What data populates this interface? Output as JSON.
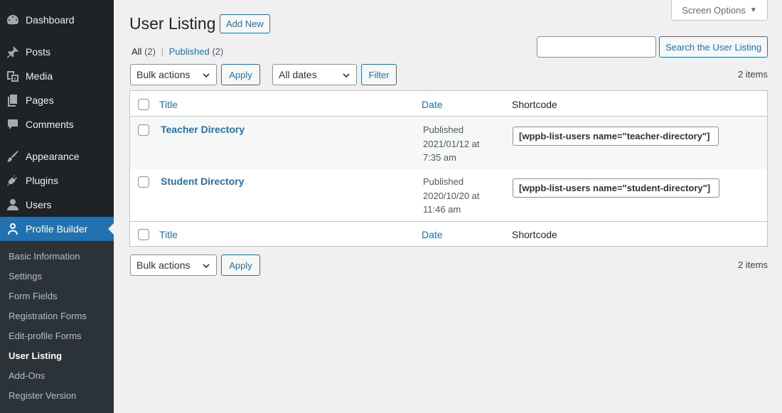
{
  "sidebar": {
    "items": [
      {
        "label": "Dashboard",
        "icon": "dashboard-icon"
      },
      {
        "label": "Posts",
        "icon": "pin-icon"
      },
      {
        "label": "Media",
        "icon": "media-icon"
      },
      {
        "label": "Pages",
        "icon": "pages-icon"
      },
      {
        "label": "Comments",
        "icon": "comment-icon"
      },
      {
        "label": "Appearance",
        "icon": "brush-icon"
      },
      {
        "label": "Plugins",
        "icon": "plugin-icon"
      },
      {
        "label": "Users",
        "icon": "users-icon"
      },
      {
        "label": "Profile Builder",
        "icon": "person-icon"
      }
    ],
    "submenu": [
      {
        "label": "Basic Information"
      },
      {
        "label": "Settings"
      },
      {
        "label": "Form Fields"
      },
      {
        "label": "Registration Forms"
      },
      {
        "label": "Edit-profile Forms"
      },
      {
        "label": "User Listing"
      },
      {
        "label": "Add-Ons"
      },
      {
        "label": "Register Version"
      }
    ]
  },
  "header": {
    "screen_options": "Screen Options",
    "title": "User Listing",
    "add_new": "Add New"
  },
  "views": {
    "all_label": "All",
    "all_count": "(2)",
    "separator": "|",
    "published_label": "Published",
    "published_count": "(2)"
  },
  "search": {
    "value": "",
    "button": "Search the User Listing"
  },
  "top_nav": {
    "bulk_actions": "Bulk actions",
    "apply": "Apply",
    "dates": "All dates",
    "filter": "Filter",
    "items_count": "2 items"
  },
  "table": {
    "columns": {
      "title": "Title",
      "date": "Date",
      "shortcode": "Shortcode"
    },
    "rows": [
      {
        "title": "Teacher Directory",
        "status": "Published",
        "date_line1": "2021/01/12 at",
        "date_line2": "7:35 am",
        "shortcode": "[wppb-list-users name=\"teacher-directory\"]"
      },
      {
        "title": "Student Directory",
        "status": "Published",
        "date_line1": "2020/10/20 at",
        "date_line2": "11:46 am",
        "shortcode": "[wppb-list-users name=\"student-directory\"]"
      }
    ]
  },
  "bottom_nav": {
    "bulk_actions": "Bulk actions",
    "apply": "Apply",
    "items_count": "2 items"
  },
  "colors": {
    "sidebar_bg": "#1d2327",
    "submenu_bg": "#2c3338",
    "accent": "#2271b1",
    "page_bg": "#f0f0f1"
  }
}
